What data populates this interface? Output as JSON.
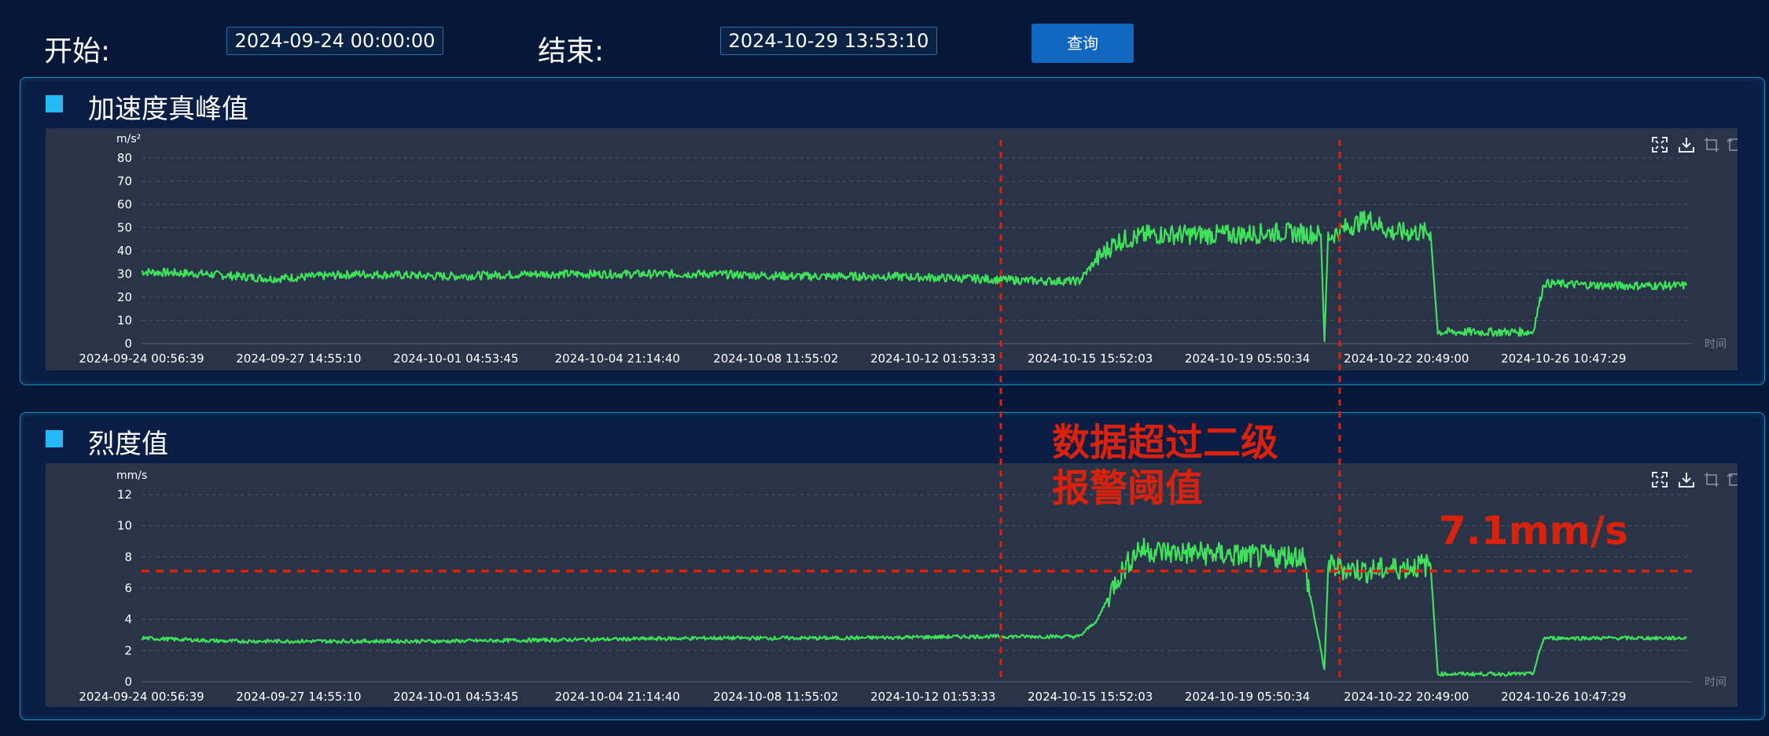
{
  "query": {
    "start_label": "开始:",
    "start_value": "2024-09-24 00:00:00",
    "end_label": "结束:",
    "end_value": "2024-10-29 13:53:10",
    "button_label": "查询"
  },
  "toolbar_icons": [
    "fullscreen-icon",
    "download-icon",
    "zoom-select-icon",
    "zoom-reset-icon"
  ],
  "annotation": {
    "text_line1": "数据超过二级",
    "text_line2": "报警阈值",
    "threshold_label": "7.1mm/s",
    "color": "#d9220d"
  },
  "chart_data": [
    {
      "type": "line",
      "title": "加速度真峰值",
      "ylabel": "m/s²",
      "xlabel": "时间",
      "ylim": [
        0,
        80
      ],
      "yticks": [
        0,
        10,
        20,
        30,
        40,
        50,
        60,
        70,
        80
      ],
      "xticks": [
        "2024-09-24 00:56:39",
        "2024-09-27 14:55:10",
        "2024-10-01 04:53:45",
        "2024-10-04 21:14:40",
        "2024-10-08 11:55:02",
        "2024-10-12 01:53:33",
        "2024-10-15 15:52:03",
        "2024-10-19 05:50:34",
        "2024-10-22 20:49:00",
        "2024-10-26 10:47:29"
      ],
      "line_color": "#3fe05a",
      "grid": true,
      "series": [
        {
          "points": [
            [
              "2024-09-24 00:56",
              31
            ],
            [
              "2024-09-25 12:00",
              30
            ],
            [
              "2024-09-27 00:00",
              28
            ],
            [
              "2024-09-29 00:00",
              30
            ],
            [
              "2024-10-01 00:00",
              29
            ],
            [
              "2024-10-03 00:00",
              30
            ],
            [
              "2024-10-05 00:00",
              30
            ],
            [
              "2024-10-07 00:00",
              30
            ],
            [
              "2024-10-09 00:00",
              29
            ],
            [
              "2024-10-11 00:00",
              29
            ],
            [
              "2024-10-13 00:00",
              28
            ],
            [
              "2024-10-14 12:00",
              27
            ],
            [
              "2024-10-15 10:00",
              27
            ],
            [
              "2024-10-15 18:00",
              35
            ],
            [
              "2024-10-16 06:00",
              44
            ],
            [
              "2024-10-17 00:00",
              47
            ],
            [
              "2024-10-18 00:00",
              47
            ],
            [
              "2024-10-19 00:00",
              47
            ],
            [
              "2024-10-20 00:00",
              48
            ],
            [
              "2024-10-20 22:00",
              47
            ],
            [
              "2024-10-21 00:00",
              1
            ],
            [
              "2024-10-21 02:00",
              46
            ],
            [
              "2024-10-21 12:00",
              50
            ],
            [
              "2024-10-22 00:00",
              54
            ],
            [
              "2024-10-22 12:00",
              48
            ],
            [
              "2024-10-23 10:00",
              48
            ],
            [
              "2024-10-23 14:00",
              5
            ],
            [
              "2024-10-24 12:00",
              5
            ],
            [
              "2024-10-25 18:00",
              5
            ],
            [
              "2024-10-26 00:00",
              26
            ],
            [
              "2024-10-27 12:00",
              25
            ],
            [
              "2024-10-29 06:00",
              25
            ]
          ]
        }
      ]
    },
    {
      "type": "line",
      "title": "烈度值",
      "ylabel": "mm/s",
      "xlabel": "时间",
      "ylim": [
        0,
        12
      ],
      "yticks": [
        0,
        2,
        4,
        6,
        8,
        10,
        12
      ],
      "xticks": [
        "2024-09-24 00:56:39",
        "2024-09-27 14:55:10",
        "2024-10-01 04:53:45",
        "2024-10-04 21:14:40",
        "2024-10-08 11:55:02",
        "2024-10-12 01:53:33",
        "2024-10-15 15:52:03",
        "2024-10-19 05:50:34",
        "2024-10-22 20:49:00",
        "2024-10-26 10:47:29"
      ],
      "line_color": "#3fe05a",
      "grid": true,
      "threshold": 7.1,
      "series": [
        {
          "points": [
            [
              "2024-09-24 00:56",
              2.8
            ],
            [
              "2024-09-26 00:00",
              2.6
            ],
            [
              "2024-09-28 00:00",
              2.6
            ],
            [
              "2024-10-01 00:00",
              2.6
            ],
            [
              "2024-10-04 00:00",
              2.7
            ],
            [
              "2024-10-07 00:00",
              2.8
            ],
            [
              "2024-10-10 00:00",
              2.8
            ],
            [
              "2024-10-13 00:00",
              2.9
            ],
            [
              "2024-10-15 10:00",
              2.9
            ],
            [
              "2024-10-15 20:00",
              4.0
            ],
            [
              "2024-10-16 06:00",
              6.5
            ],
            [
              "2024-10-16 18:00",
              8.5
            ],
            [
              "2024-10-17 12:00",
              8.3
            ],
            [
              "2024-10-18 12:00",
              8.2
            ],
            [
              "2024-10-19 12:00",
              8.0
            ],
            [
              "2024-10-20 12:00",
              8.1
            ],
            [
              "2024-10-21 00:00",
              0.8
            ],
            [
              "2024-10-21 02:00",
              7.4
            ],
            [
              "2024-10-22 00:00",
              7.1
            ],
            [
              "2024-10-23 10:00",
              7.5
            ],
            [
              "2024-10-23 14:00",
              0.5
            ],
            [
              "2024-10-24 12:00",
              0.5
            ],
            [
              "2024-10-25 18:00",
              0.5
            ],
            [
              "2024-10-26 00:00",
              2.8
            ],
            [
              "2024-10-27 12:00",
              2.8
            ],
            [
              "2024-10-29 06:00",
              2.8
            ]
          ]
        }
      ]
    }
  ]
}
